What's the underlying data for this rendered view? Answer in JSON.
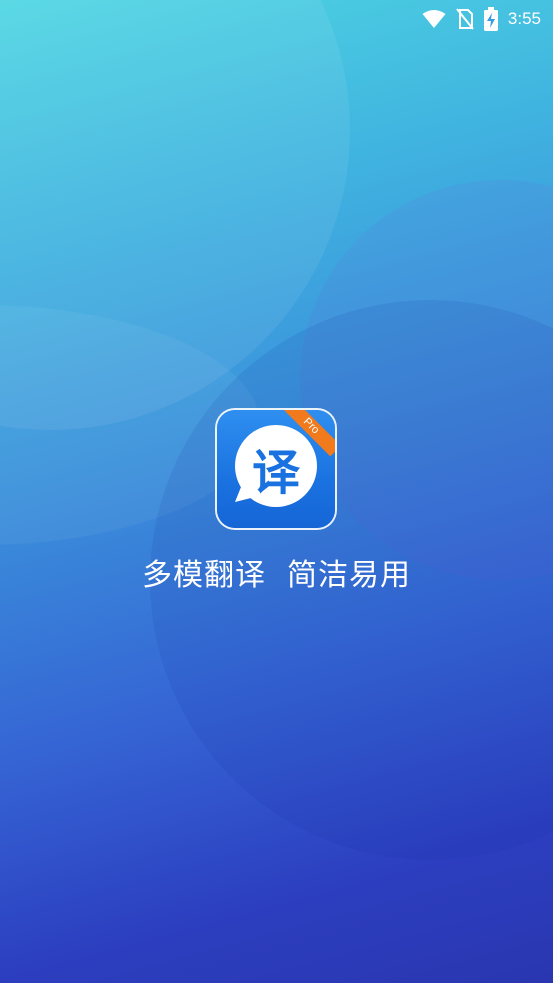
{
  "status_bar": {
    "time": "3:55",
    "icons": [
      "wifi-icon",
      "no-sim-icon",
      "battery-charging-icon"
    ]
  },
  "app": {
    "logo_char": "译",
    "badge": "Pro",
    "tagline": "多模翻译  简洁易用"
  },
  "colors": {
    "gradient_top": "#4fd6e2",
    "gradient_bottom": "#2a36b0",
    "logo_blue": "#1a72e0",
    "badge_orange": "#f07a1c"
  }
}
